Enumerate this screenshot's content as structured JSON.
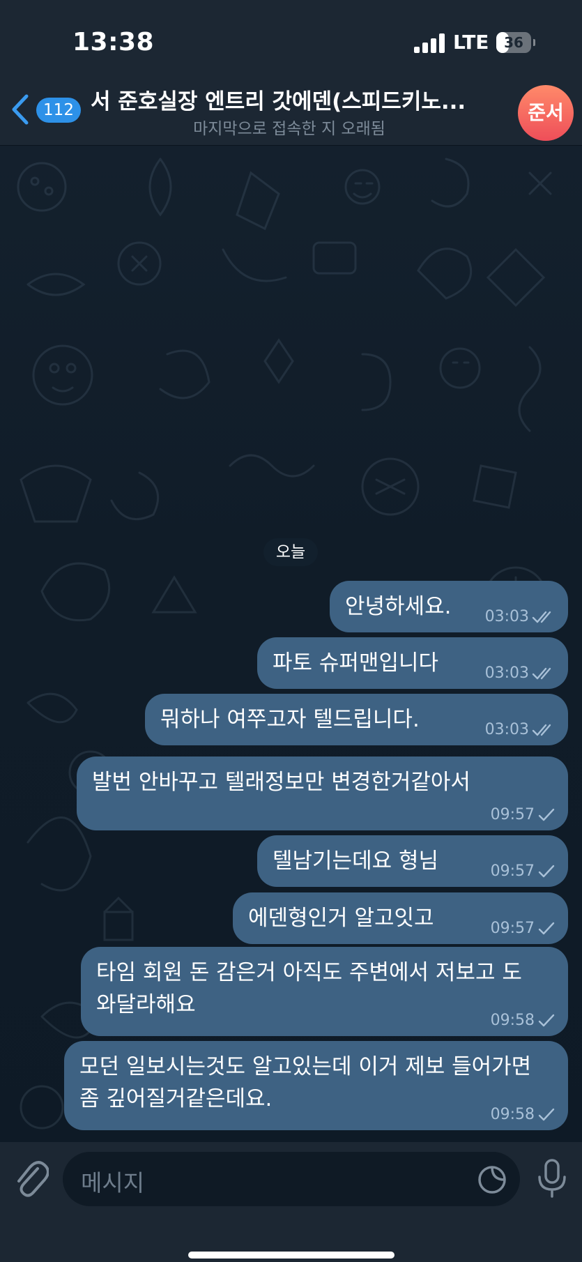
{
  "status_bar": {
    "time": "13:38",
    "network": "LTE",
    "battery": "36",
    "battery_fraction": 0.36
  },
  "header": {
    "back_badge": "112",
    "title": "서 준호실장 엔트리 갓에덴(스피드키노...",
    "subtitle": "마지막으로 접속한 지 오래됨",
    "avatar_initials": "준서",
    "avatar_gradient": [
      "#ff8a6a",
      "#ee4e59"
    ]
  },
  "chat": {
    "date_separator": "오늘",
    "messages": [
      {
        "text": "안녕하세요.",
        "time": "03:03",
        "status": "read"
      },
      {
        "text": "파토 슈퍼맨입니다",
        "time": "03:03",
        "status": "read"
      },
      {
        "text": "뭐하나 여쭈고자 텔드립니다.",
        "time": "03:03",
        "status": "read"
      },
      {
        "text": "발번 안바꾸고 텔래정보만 변경한거같아서",
        "time": "09:57",
        "status": "sent"
      },
      {
        "text": "텔남기는데요 형님",
        "time": "09:57",
        "status": "sent"
      },
      {
        "text": "에덴형인거 알고잇고",
        "time": "09:57",
        "status": "sent"
      },
      {
        "text": "타임 회원 돈 감은거 아직도 주변에서 저보고 도와달라해요",
        "time": "09:58",
        "status": "sent"
      },
      {
        "text": "모던 일보시는것도 알고있는데 이거 제보 들어가면 좀 깊어질거같은데요.",
        "time": "09:58",
        "status": "sent"
      }
    ]
  },
  "input": {
    "placeholder": "메시지"
  },
  "colors": {
    "bubble_out": "#3e6283",
    "header_bg": "#1c2733",
    "accent": "#2d91e8"
  },
  "icons": [
    "back-chevron-icon",
    "signal-icon",
    "battery-icon",
    "paperclip-icon",
    "sticker-icon",
    "microphone-icon",
    "double-check-icon",
    "single-check-icon"
  ]
}
